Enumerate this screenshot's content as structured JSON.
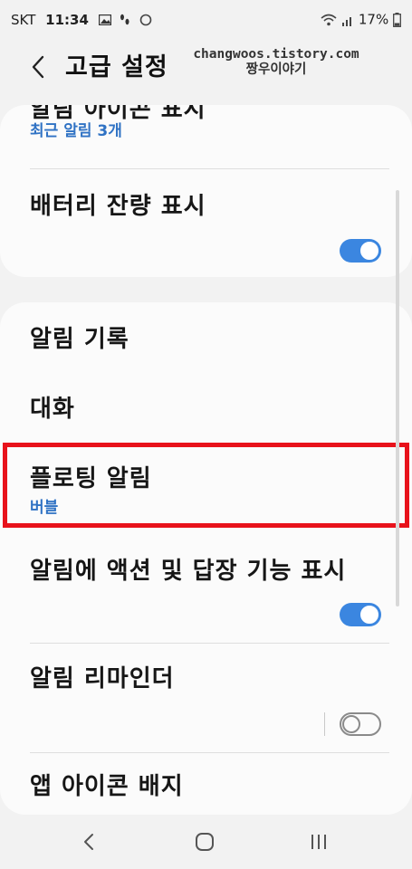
{
  "status_bar": {
    "carrier": "SKT",
    "time": "11:34",
    "battery": "17%"
  },
  "header": {
    "title": "고급 설정",
    "watermark_line1": "changwoos.tistory.com",
    "watermark_line2": "짱우이야기"
  },
  "card1": {
    "row1_label": "알림 아이콘 표시",
    "row1_sub": "최근 알림 3개",
    "row2_label": "배터리 잔량 표시",
    "row2_toggle": true
  },
  "card2": {
    "rows": [
      {
        "label": "알림 기록"
      },
      {
        "label": "대화"
      },
      {
        "label": "플로팅 알림",
        "sub": "버블"
      },
      {
        "label": "알림에 액션 및 답장 기능 표시",
        "toggle": true
      },
      {
        "label": "알림 리마인더",
        "toggle": false
      },
      {
        "label": "앱 아이콘 배지"
      }
    ]
  },
  "colors": {
    "accent": "#3b86e0",
    "subtext": "#2f72c4",
    "highlight": "#e8121b"
  },
  "icons": {
    "back": "chevron-left-icon",
    "nav_back": "nav-back-icon",
    "nav_home": "nav-home-icon",
    "nav_recents": "nav-recents-icon"
  }
}
